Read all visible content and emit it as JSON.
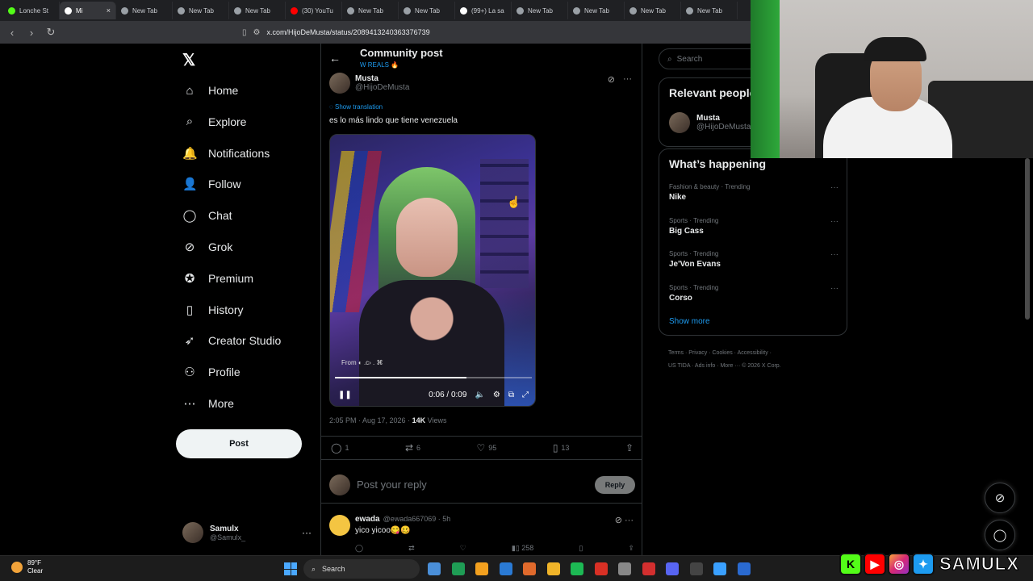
{
  "browser": {
    "tabs": [
      {
        "label": "Lonche St",
        "color": "#53fc18",
        "icon": "kick-icon"
      },
      {
        "label": "Mi",
        "color": "#ffffff",
        "icon": "x-icon",
        "active": true
      },
      {
        "label": "New Tab",
        "color": "#9aa0a6",
        "icon": "shield-icon"
      },
      {
        "label": "New Tab",
        "color": "#9aa0a6",
        "icon": "shield-icon"
      },
      {
        "label": "New Tab",
        "color": "#9aa0a6",
        "icon": "shield-icon"
      },
      {
        "label": "(30) YouTu",
        "color": "#ff0000",
        "icon": "youtube-icon"
      },
      {
        "label": "New Tab",
        "color": "#9aa0a6",
        "icon": "shield-icon"
      },
      {
        "label": "New Tab",
        "color": "#9aa0a6",
        "icon": "shield-icon"
      },
      {
        "label": "(99+) La sa",
        "color": "#ffffff",
        "icon": "tiktok-icon"
      },
      {
        "label": "New Tab",
        "color": "#9aa0a6",
        "icon": "shield-icon"
      },
      {
        "label": "New Tab",
        "color": "#9aa0a6",
        "icon": "shield-icon"
      },
      {
        "label": "New Tab",
        "color": "#9aa0a6",
        "icon": "shield-icon"
      },
      {
        "label": "New Tab",
        "color": "#9aa0a6",
        "icon": "shield-icon"
      }
    ],
    "url": "x.com/HijoDeMusta/status/2089413240363376739"
  },
  "nav": {
    "items": [
      {
        "label": "Home",
        "icon": "home-icon",
        "glyph": "⌂"
      },
      {
        "label": "Explore",
        "icon": "search-icon",
        "glyph": "⌕"
      },
      {
        "label": "Notifications",
        "icon": "bell-icon",
        "glyph": "🔔"
      },
      {
        "label": "Follow",
        "icon": "person-plus-icon",
        "glyph": "👤"
      },
      {
        "label": "Chat",
        "icon": "chat-icon",
        "glyph": "◯"
      },
      {
        "label": "Grok",
        "icon": "grok-icon",
        "glyph": "⊘"
      },
      {
        "label": "Premium",
        "icon": "premium-icon",
        "glyph": "✪"
      },
      {
        "label": "History",
        "icon": "bookmark-icon",
        "glyph": "▯"
      },
      {
        "label": "Creator Studio",
        "icon": "rocket-icon",
        "glyph": "➶"
      },
      {
        "label": "Profile",
        "icon": "profile-icon",
        "glyph": "⚇"
      },
      {
        "label": "More",
        "icon": "more-circle-icon",
        "glyph": "⋯"
      }
    ],
    "post_label": "Post",
    "user": {
      "name": "Samulx",
      "handle": "@Samulx_"
    }
  },
  "post": {
    "header_title": "Community post",
    "header_sub": "W REALS 🔥",
    "author_name": "Musta",
    "author_handle": "@HijoDeMusta",
    "show_translation": "Show translation",
    "text": "es lo más lindo que tiene venezuela",
    "media_from": "From ◐ .c› . ⌘",
    "video_time": "0:06 / 0:09",
    "video_progress": 0.667,
    "time": "2:05 PM · Aug 17, 2026 ·",
    "views_count": "14K",
    "views_label": "Views",
    "replies": "1",
    "reposts": "6",
    "likes": "95",
    "bookmarks": "13"
  },
  "reply": {
    "placeholder": "Post your reply",
    "button": "Reply"
  },
  "comment": {
    "name": "ewada",
    "handle": "@ewada667069 · 5h",
    "text": "yico yicoo😋🥴",
    "views": "258"
  },
  "right": {
    "search_placeholder": "Search",
    "relevant_title": "Relevant people",
    "relevant_name": "Musta",
    "relevant_handle": "@HijoDeMusta",
    "happening_title": "What’s happening",
    "trends": [
      {
        "category": "Fashion & beauty · Trending",
        "name": "Nike"
      },
      {
        "category": "Sports · Trending",
        "name": "Big Cass"
      },
      {
        "category": "Sports · Trending",
        "name": "Je'Von Evans"
      },
      {
        "category": "Sports · Trending",
        "name": "Corso"
      }
    ],
    "show_more": "Show more",
    "footer1": "Terms · Privacy · Cookies · Accessibility ·",
    "footer2": "US TIDA · Ads info · More ··· © 2026 X Corp."
  },
  "taskbar": {
    "temp": "89°F",
    "weather": "Clear",
    "search": "Search",
    "brand": "SAMULX"
  }
}
